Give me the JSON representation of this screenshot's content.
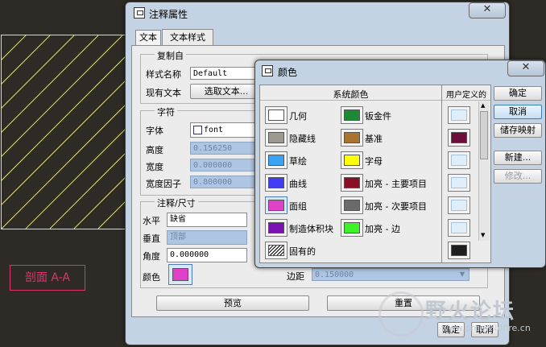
{
  "canvas": {
    "section_label": "剖面 A-A",
    "watermark_text": "野火论坛",
    "watermark_url": "www.proewildfire.cn"
  },
  "main_dialog": {
    "title": "注释属性",
    "close_glyph": "✕",
    "tabs": [
      "文本",
      "文本样式"
    ],
    "copy_group": {
      "title": "复制自",
      "style_name_label": "样式名称",
      "style_name_value": "Default",
      "existing_text_label": "现有文本",
      "select_text_button": "选取文本..."
    },
    "char_group": {
      "title": "字符",
      "font_label": "字体",
      "font_value": "font",
      "height_label": "高度",
      "height_value": "0.156250",
      "width_label": "宽度",
      "width_value": "0.000000",
      "width_factor_label": "宽度因子",
      "width_factor_value": "0.800000"
    },
    "note_group": {
      "title": "注释/尺寸",
      "horizontal_label": "水平",
      "horizontal_value": "缺省",
      "vertical_label": "垂直",
      "vertical_value": "顶部",
      "angle_label": "角度",
      "angle_value": "0.000000",
      "color_label": "颜色",
      "color_value": "#e041c9",
      "margin_label": "边距",
      "margin_value": "0.150000"
    },
    "preview_button": "预览",
    "reset_button": "重置",
    "ok_button": "确定",
    "cancel_button": "取消"
  },
  "color_dialog": {
    "title": "颜色",
    "close_glyph": "✕",
    "system_header": "系统颜色",
    "user_header": "用户定义的",
    "system_colors": [
      {
        "name": "几何",
        "color": "#ffffff"
      },
      {
        "name": "隐藏线",
        "color": "#9d9890"
      },
      {
        "name": "草绘",
        "color": "#3aa3f4"
      },
      {
        "name": "曲线",
        "color": "#3f3cf3"
      },
      {
        "name": "面组",
        "color": "#e041c9"
      },
      {
        "name": "制造体积块",
        "color": "#7a12b3"
      },
      {
        "name": "固有的",
        "color": "pattern"
      },
      {
        "name": "钣金件",
        "color": "#1c8a32"
      },
      {
        "name": "基准",
        "color": "#a8742f"
      },
      {
        "name": "字母",
        "color": "#ffff05"
      },
      {
        "name": "加亮 - 主要项目",
        "color": "#8a0f26"
      },
      {
        "name": "加亮 - 次要项目",
        "color": "#6a6a6a"
      },
      {
        "name": "加亮 - 边",
        "color": "#3ef22a"
      }
    ],
    "user_colors": [
      "#e0eefa",
      "#6c0f3c",
      "#e0eefa",
      "#e0eefa",
      "#e0eefa",
      "#e0eefa",
      "#1e1e1e"
    ],
    "buttons": {
      "ok": "确定",
      "cancel": "取消",
      "store_map": "储存映射",
      "new": "新建...",
      "modify": "修改..."
    },
    "scroll_up": "▲",
    "scroll_down": "▼"
  }
}
